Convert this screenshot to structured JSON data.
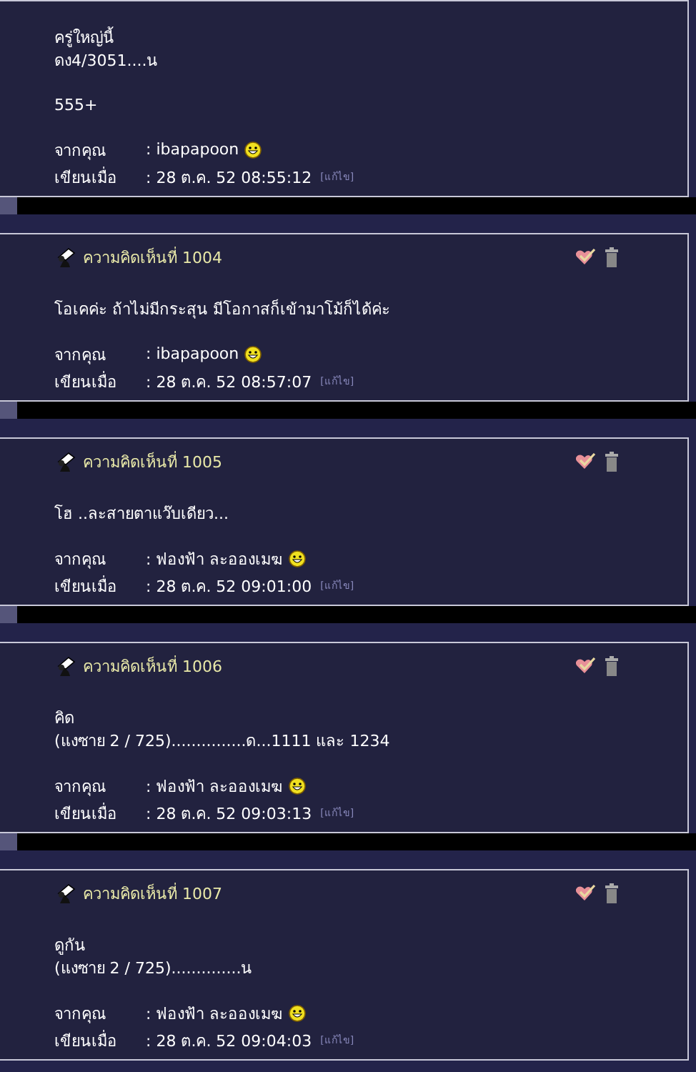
{
  "comments": [
    {
      "body": [
        "ครู่ใหญ่นี้\nดง4/3051....น",
        "555+"
      ],
      "from_label": "จากคุณ",
      "author": ": ibapapoon",
      "date_label": "เขียนเมื่อ",
      "date": ": 28 ต.ค. 52 08:55:12",
      "edit": "[แก้ไข]"
    },
    {
      "title": "ความคิดเห็นที่ 1004",
      "body": [
        "โอเคค่ะ ถ้าไม่มีกระสุน มีโอกาสก็เข้ามาโม้ก็ได้ค่ะ"
      ],
      "from_label": "จากคุณ",
      "author": ": ibapapoon",
      "date_label": "เขียนเมื่อ",
      "date": ": 28 ต.ค. 52 08:57:07",
      "edit": "[แก้ไข]"
    },
    {
      "title": "ความคิดเห็นที่ 1005",
      "body": [
        "โฮ ..ละสายตาแว๊บเดียว..."
      ],
      "from_label": "จากคุณ",
      "author": ": ฟองฟ้า ละอองเมฆ",
      "date_label": "เขียนเมื่อ",
      "date": ": 28 ต.ค. 52 09:01:00",
      "edit": "[แก้ไข]"
    },
    {
      "title": "ความคิดเห็นที่ 1006",
      "body": [
        "คิด\n(แงซาย 2 / 725)...............ด...1111 และ 1234"
      ],
      "from_label": "จากคุณ",
      "author": ": ฟองฟ้า ละอองเมฆ",
      "date_label": "เขียนเมื่อ",
      "date": ": 28 ต.ค. 52 09:03:13",
      "edit": "[แก้ไข]"
    },
    {
      "title": "ความคิดเห็นที่ 1007",
      "body": [
        "ดูกัน\n(แงซาย 2 / 725)..............น"
      ],
      "from_label": "จากคุณ",
      "author": ": ฟองฟ้า ละอองเมฆ",
      "date_label": "เขียนเมื่อ",
      "date": ": 28 ต.ค. 52 09:04:03",
      "edit": "[แก้ไข]"
    }
  ]
}
